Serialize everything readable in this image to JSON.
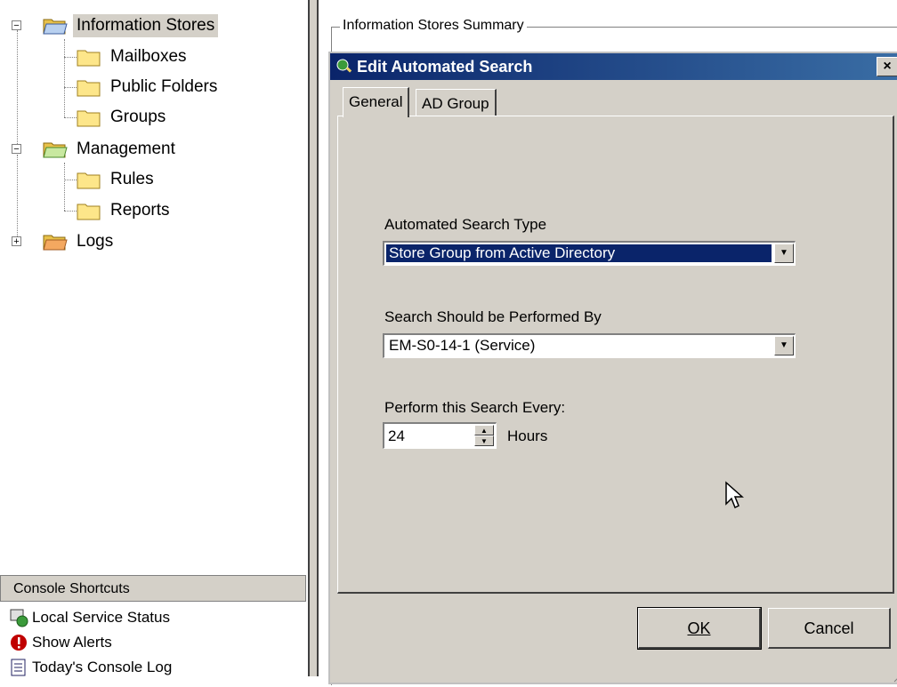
{
  "tree": {
    "items": [
      {
        "label": "Information Stores",
        "icon": "folder-open-icon",
        "expander": "−"
      },
      {
        "label": "Mailboxes",
        "icon": "folder-icon"
      },
      {
        "label": "Public Folders",
        "icon": "folder-icon"
      },
      {
        "label": "Groups",
        "icon": "folder-icon"
      },
      {
        "label": "Management",
        "icon": "folder-open-icon",
        "expander": "−"
      },
      {
        "label": "Rules",
        "icon": "folder-icon"
      },
      {
        "label": "Reports",
        "icon": "folder-icon"
      },
      {
        "label": "Logs",
        "icon": "folder-open-icon",
        "expander": "+"
      }
    ]
  },
  "shortcuts": {
    "header": "Console Shortcuts",
    "items": [
      {
        "label": "Local Service Status",
        "icon": "service-status-icon"
      },
      {
        "label": "Show Alerts",
        "icon": "alert-icon"
      },
      {
        "label": "Today's Console Log",
        "icon": "log-icon"
      }
    ]
  },
  "right": {
    "summary_title": "Information Stores Summary"
  },
  "dialog": {
    "title": "Edit Automated Search",
    "close": "×",
    "tabs": [
      "General",
      "AD Group"
    ],
    "search_type_label": "Automated Search Type",
    "search_type_value": "Store Group from Active Directory",
    "performed_by_label": "Search Should be Performed By",
    "performed_by_value": "EM-S0-14-1 (Service)",
    "every_label": "Perform this Search Every:",
    "every_value": "24",
    "every_unit": "Hours",
    "ok": "OK",
    "cancel": "Cancel"
  },
  "colors": {
    "titlebar_start": "#0a246a",
    "titlebar_end": "#3a6ea5",
    "face": "#d4d0c8",
    "selection": "#0a246a"
  }
}
